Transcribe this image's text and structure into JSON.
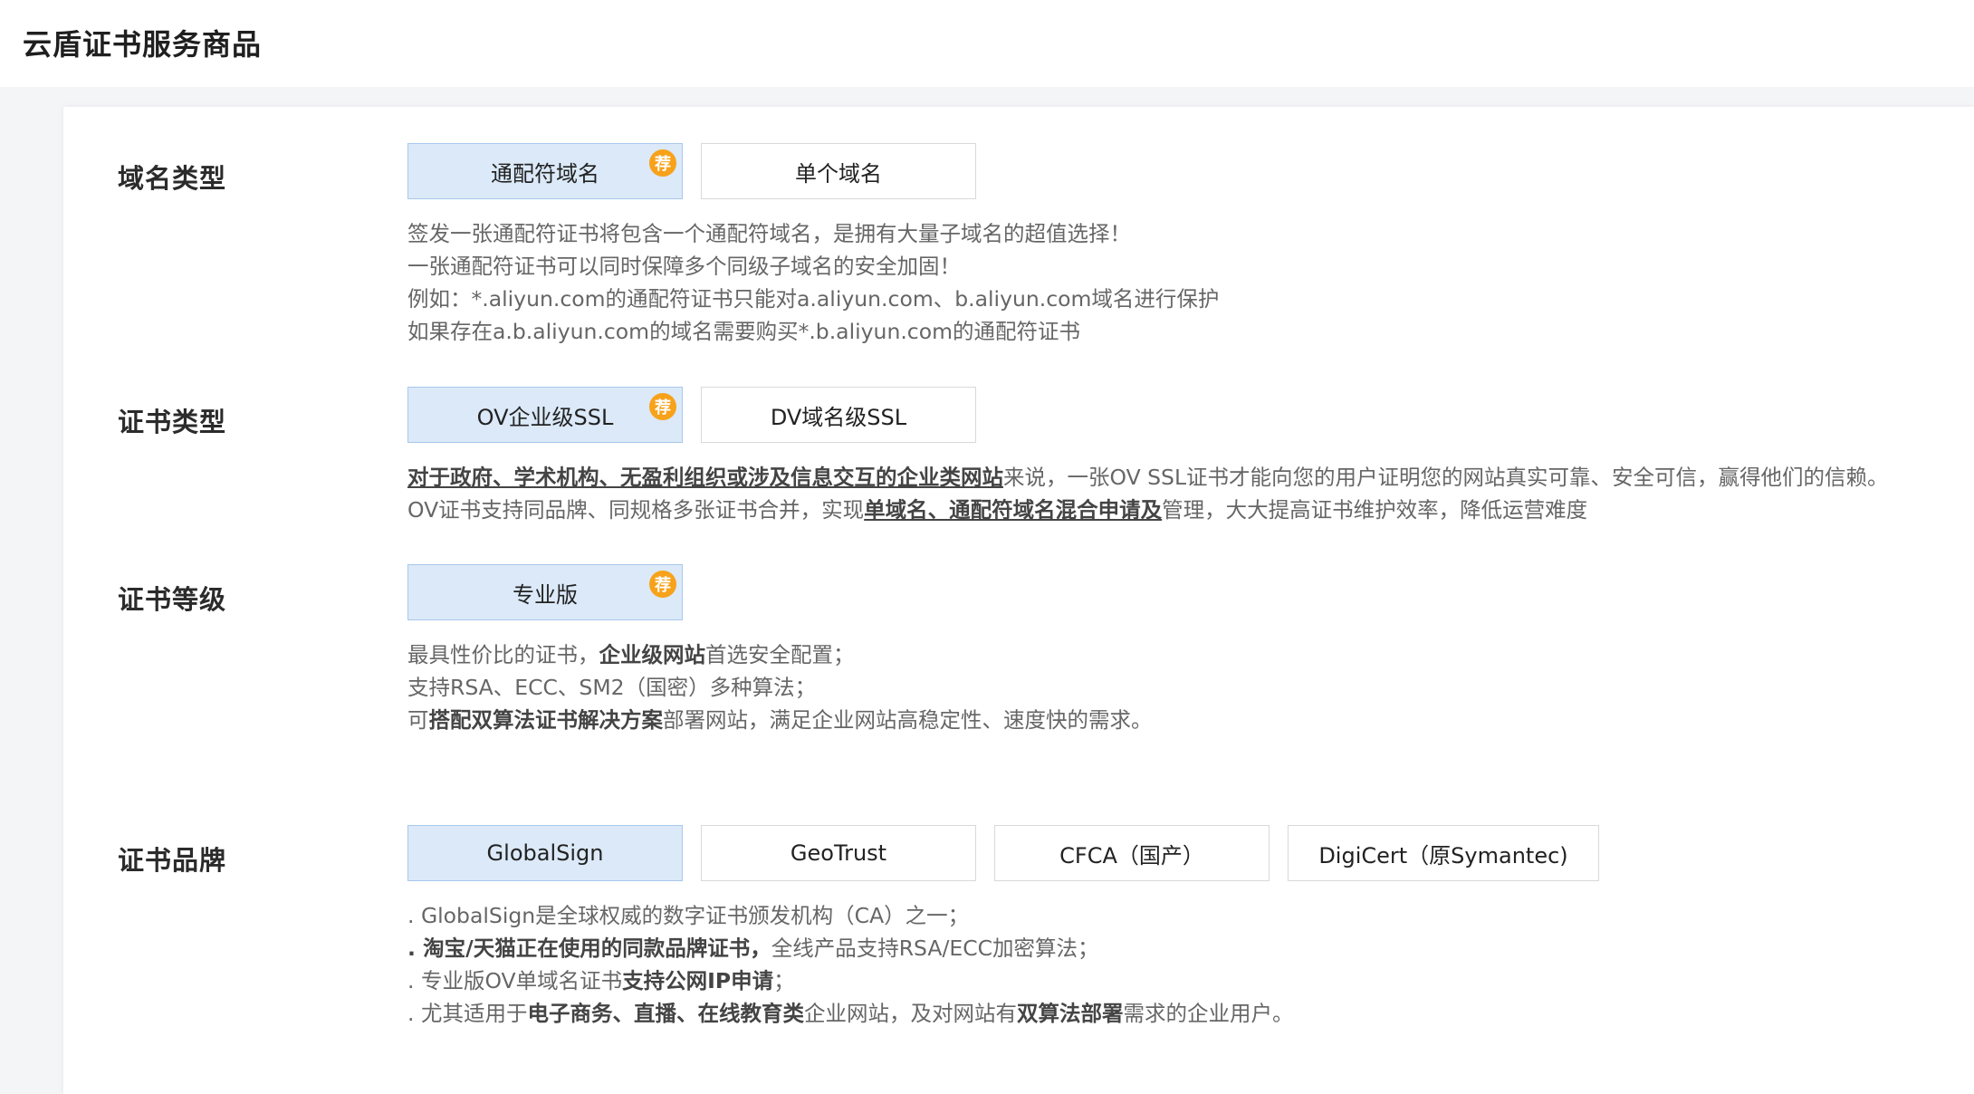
{
  "page": {
    "title": "云盾证书服务商品"
  },
  "domain_type": {
    "label": "域名类型",
    "options": [
      {
        "label": "通配符域名",
        "badge": "荐",
        "selected": true
      },
      {
        "label": "单个域名",
        "selected": false
      }
    ],
    "desc": [
      "签发一张通配符证书将包含一个通配符域名，是拥有大量子域名的超值选择！",
      "一张通配符证书可以同时保障多个同级子域名的安全加固！",
      "例如：*.aliyun.com的通配符证书只能对a.aliyun.com、b.aliyun.com域名进行保护",
      "如果存在a.b.aliyun.com的域名需要购买*.b.aliyun.com的通配符证书"
    ]
  },
  "cert_type": {
    "label": "证书类型",
    "options": [
      {
        "label": "OV企业级SSL",
        "badge": "荐",
        "selected": true
      },
      {
        "label": "DV域名级SSL",
        "selected": false
      }
    ],
    "desc1": {
      "underlined": "对于政府、学术机构、无盈利组织或涉及信息交互的企业类网站",
      "rest": "来说，一张OV SSL证书才能向您的用户证明您的网站真实可靠、安全可信，赢得他们的信赖。"
    },
    "desc2": {
      "prefix": "OV证书支持同品牌、同规格多张证书合并，实现",
      "underlined": "单域名、通配符域名混合申请及",
      "suffix": "管理，大大提高证书维护效率，降低运营难度"
    }
  },
  "cert_level": {
    "label": "证书等级",
    "options": [
      {
        "label": "专业版",
        "badge": "荐",
        "selected": true
      }
    ],
    "desc1": {
      "prefix": "最具性价比的证书，",
      "bold": "企业级网站",
      "suffix": "首选安全配置；"
    },
    "desc2": "支持RSA、ECC、SM2（国密）多种算法；",
    "desc3": {
      "prefix": "可",
      "bold": "搭配双算法证书解决方案",
      "suffix": "部署网站，满足企业网站高稳定性、速度快的需求。"
    }
  },
  "cert_brand": {
    "label": "证书品牌",
    "options": [
      {
        "label": "GlobalSign",
        "selected": true
      },
      {
        "label": "GeoTrust",
        "selected": false
      },
      {
        "label": "CFCA（国产）",
        "selected": false
      },
      {
        "label": "DigiCert（原Symantec)",
        "selected": false
      }
    ],
    "desc1": ". GlobalSign是全球权威的数字证书颁发机构（CA）之一；",
    "desc2": {
      "bold": ". 淘宝/天猫正在使用的同款品牌证书，",
      "suffix": "全线产品支持RSA/ECC加密算法；"
    },
    "desc3": {
      "prefix": ". 专业版OV单域名证书",
      "bold": "支持公网IP申请",
      "suffix": "；"
    },
    "desc4": {
      "p1": ". 尤其适用于",
      "b1": "电子商务、直播、在线教育类",
      "p2": "企业网站，及对网站有",
      "b2": "双算法部署",
      "p3": "需求的企业用户。"
    }
  },
  "colors": {
    "selected_bg": "#dbe9f8",
    "selected_border": "#a8c8ec",
    "badge": "#f7a21a"
  }
}
